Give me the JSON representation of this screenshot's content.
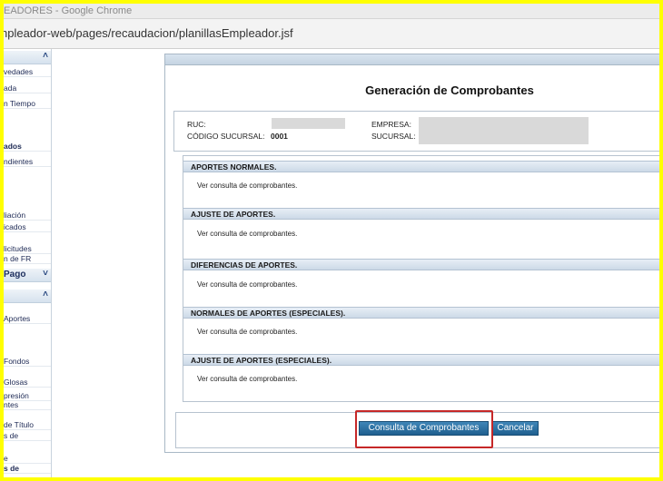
{
  "window": {
    "title": "EADORES - Google Chrome",
    "url": "npleador-web/pages/recaudacion/planillasEmpleador.jsf"
  },
  "sidebar": {
    "headers": [
      {
        "label": "",
        "chevron": "chevron-up-icon"
      },
      {
        "label": "Pago",
        "chevron": "chevron-down-icon"
      },
      {
        "label": "",
        "chevron": "chevron-up-icon"
      }
    ],
    "items": [
      {
        "label": "vedades"
      },
      {
        "label": "ada"
      },
      {
        "label": "n Tiempo"
      },
      {
        "label": "ados"
      },
      {
        "label": "ndientes"
      },
      {
        "label": "liación"
      },
      {
        "label": "icados"
      },
      {
        "label": "licitudes"
      },
      {
        "label": "n de FR"
      },
      {
        "label": "Aportes"
      },
      {
        "label": "Fondos"
      },
      {
        "label": "Glosas"
      },
      {
        "label": "presión"
      },
      {
        "label": "ntes"
      },
      {
        "label": "de Título"
      },
      {
        "label": "s de"
      },
      {
        "label": "e"
      },
      {
        "label": "s de"
      }
    ]
  },
  "page": {
    "title": "Generación de Comprobantes",
    "info": {
      "ruc_label": "RUC:",
      "codigo_label": "CÓDIGO SUCURSAL:",
      "codigo_value": "0001",
      "empresa_label": "EMPRESA:",
      "sucursal_label": "SUCURSAL:"
    },
    "sections": [
      {
        "title": "APORTES NORMALES.",
        "link": "Ver consulta de comprobantes."
      },
      {
        "title": "AJUSTE DE APORTES.",
        "link": "Ver consulta de comprobantes."
      },
      {
        "title": "DIFERENCIAS DE APORTES.",
        "link": "Ver consulta de comprobantes."
      },
      {
        "title": "NORMALES DE APORTES (ESPECIALES).",
        "link": "Ver consulta de comprobantes."
      },
      {
        "title": "AJUSTE DE APORTES (ESPECIALES).",
        "link": "Ver consulta de comprobantes."
      }
    ],
    "buttons": {
      "consulta": "Consulta de Comprobantes",
      "cancelar": "Cancelar"
    }
  },
  "colors": {
    "frame_border": "#ffff00",
    "highlight": "#c62828",
    "button": "#2a6a9c",
    "section_header": "#d7e2ee"
  }
}
